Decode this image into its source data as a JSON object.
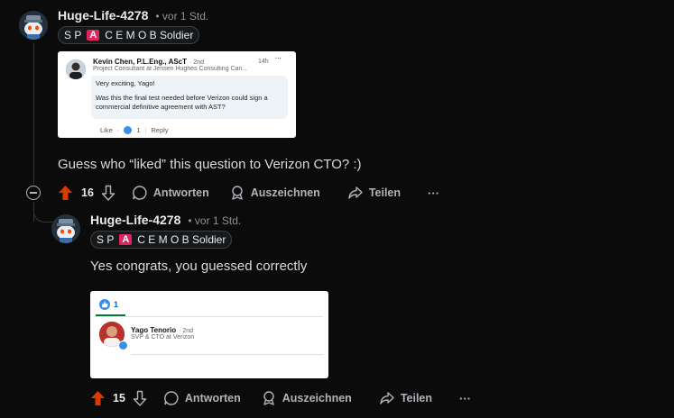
{
  "top_comment": {
    "username": "Huge-Life-4278",
    "time": "• vor 1 Std.",
    "flair": {
      "parts": [
        "S P",
        "A",
        "C E M O B Soldier"
      ]
    },
    "body": "Guess who “liked” this question to Verizon CTO? :)",
    "votes": "16",
    "actions": {
      "reply": "Antworten",
      "award": "Auszeichnen",
      "share": "Teilen",
      "more": "···"
    },
    "embed": {
      "name": "Kevin Chen, P.L.Eng., AScT",
      "degree": "· 2nd",
      "headline": "Project Consultant at Jensen Hughes Consulting Can...",
      "age": "14h",
      "greeting": "Very exciting, Yago!",
      "question": "Was this the final test needed before Verizon could sign a commercial definitive agreement with AST?",
      "like": "Like",
      "like_count": "1",
      "reply": "Reply"
    }
  },
  "reply_comment": {
    "username": "Huge-Life-4278",
    "time": "• vor 1 Std.",
    "flair": {
      "parts": [
        "S P",
        "A",
        "C E M O B Soldier"
      ]
    },
    "body": "Yes congrats, you guessed correctly",
    "votes": "15",
    "actions": {
      "reply": "Antworten",
      "award": "Auszeichnen",
      "share": "Teilen",
      "more": "···"
    },
    "embed": {
      "tab_count": "1",
      "name": "Yago Tenorio",
      "degree": "· 2nd",
      "headline": "SVP & CTO at Verizon"
    }
  },
  "colors": {
    "upvote": "#d93a00",
    "linkedin_blue": "#0a66c2",
    "flair_red": "#e0245e"
  }
}
